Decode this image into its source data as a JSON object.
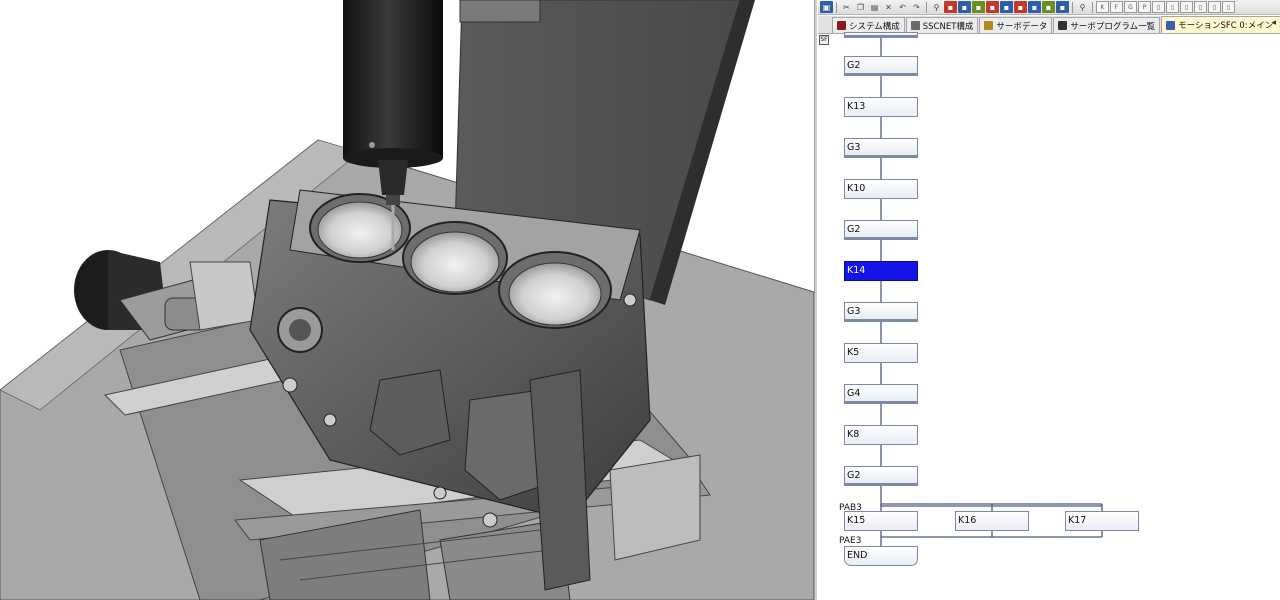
{
  "tabs": [
    {
      "label": "システム構成",
      "icon_color": "#8b1a1a"
    },
    {
      "label": "SSCNET構成",
      "icon_color": "#6a6a6a"
    },
    {
      "label": "サーボデータ",
      "icon_color": "#b08a22"
    },
    {
      "label": "サーボプログラム一覧",
      "icon_color": "#333333"
    },
    {
      "label": "モーションSFC 0:メイン",
      "icon_color": "#3a5ea8",
      "active": true
    }
  ],
  "tab_close_glyph": "×",
  "sfc": {
    "marker": "SF",
    "steps": [
      {
        "label": "G2",
        "kind": "transition"
      },
      {
        "label": "K13",
        "kind": "step"
      },
      {
        "label": "G3",
        "kind": "transition"
      },
      {
        "label": "K10",
        "kind": "step"
      },
      {
        "label": "G2",
        "kind": "transition"
      },
      {
        "label": "K14",
        "kind": "step",
        "selected": true
      },
      {
        "label": "G3",
        "kind": "transition"
      },
      {
        "label": "K5",
        "kind": "step"
      },
      {
        "label": "G4",
        "kind": "transition"
      },
      {
        "label": "K8",
        "kind": "step"
      },
      {
        "label": "G2",
        "kind": "transition"
      }
    ],
    "parallel_begin": "PAB3",
    "parallel_branches": [
      "K15",
      "K16",
      "K17"
    ],
    "parallel_end": "PAE3",
    "end_label": "END"
  },
  "colors": {
    "selected_step": "#1414e6",
    "connector": "#4a5a80",
    "active_tab": "#fff7cf"
  },
  "viewport": {
    "scene": "3D machining cell: vertical spindle drilling a 3-cylinder engine block on an X-Y table with servo motor"
  }
}
